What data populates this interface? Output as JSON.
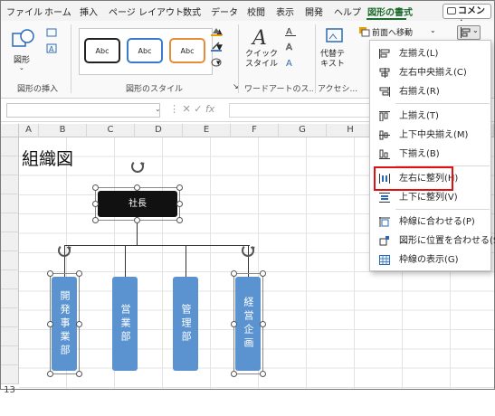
{
  "tabs": [
    "ファイル",
    "ホーム",
    "挿入",
    "ページ レイアウト",
    "数式",
    "データ",
    "校閲",
    "表示",
    "開発",
    "ヘルプ",
    "図形の書式"
  ],
  "comment_label": "コメント",
  "ribbon": {
    "insert_shape_btn": "図形",
    "group_insert_shapes": "図形の挿入",
    "style_samples": [
      "Abc",
      "Abc",
      "Abc"
    ],
    "group_shape_styles": "図形のスタイル",
    "quick_styles": "クイック\nスタイル",
    "group_wordart": "ワードアートのス...",
    "alt_text": "代替テ\nキスト",
    "group_accessibility": "アクセシ...",
    "bring_forward": "前面へ移動"
  },
  "columns": [
    "A",
    "B",
    "C",
    "D",
    "E",
    "F",
    "G",
    "H"
  ],
  "rows": [
    "1",
    "2",
    "3",
    "4",
    "5",
    "6",
    "7",
    "8",
    "9",
    "10",
    "11",
    "12",
    "13"
  ],
  "sheet": {
    "title": "組織図",
    "president": "社長",
    "departments": [
      "開発事業部",
      "営業部",
      "管理部",
      "経営企画"
    ]
  },
  "menu": {
    "items": [
      {
        "label": "左揃え(L)",
        "icon": "align-left-icon"
      },
      {
        "label": "左右中央揃え(C)",
        "icon": "align-center-icon"
      },
      {
        "label": "右揃え(R)",
        "icon": "align-right-icon"
      },
      {
        "label": "上揃え(T)",
        "icon": "align-top-icon"
      },
      {
        "label": "上下中央揃え(M)",
        "icon": "align-middle-icon"
      },
      {
        "label": "下揃え(B)",
        "icon": "align-bottom-icon"
      },
      {
        "label": "左右に整列(H)",
        "icon": "distribute-horizontal-icon"
      },
      {
        "label": "上下に整列(V)",
        "icon": "distribute-vertical-icon"
      },
      {
        "label": "枠線に合わせる(P)",
        "icon": "snap-to-grid-icon"
      },
      {
        "label": "図形に位置を合わせる(S)",
        "icon": "snap-to-shape-icon"
      },
      {
        "label": "枠線の表示(G)",
        "icon": "view-gridlines-icon"
      }
    ]
  },
  "colors": {
    "accent": "#1d6b2f",
    "dept_fill": "#5b93d0",
    "president_fill": "#111111",
    "highlight": "#e01010"
  }
}
